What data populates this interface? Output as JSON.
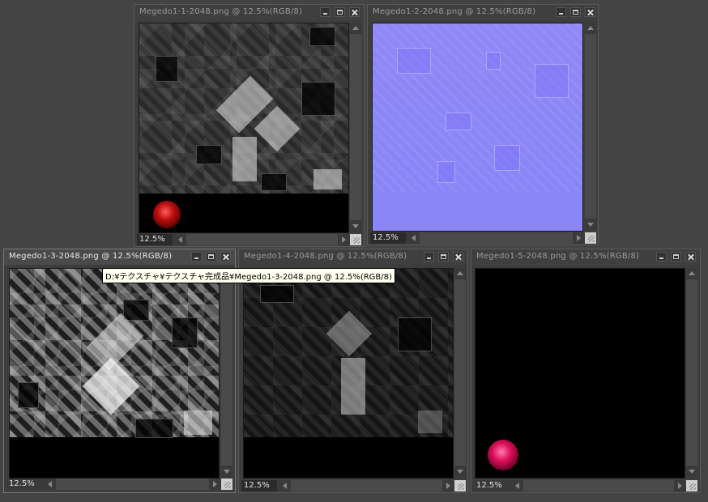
{
  "windows": [
    {
      "title": "Megedo1-1-2048.png @ 12.5%(RGB/8)",
      "zoom": "12.5%"
    },
    {
      "title": "Megedo1-2-2048.png @ 12.5%(RGB/8)",
      "zoom": "12.5%"
    },
    {
      "title": "Megedo1-3-2048.png @ 12.5%(RGB/8)",
      "zoom": "12.5%"
    },
    {
      "title": "Megedo1-4-2048.png @ 12.5%(RGB/8)",
      "zoom": "12.5%"
    },
    {
      "title": "Megedo1-5-2048.png @ 12.5%(RGB/8)",
      "zoom": "12.5%"
    }
  ],
  "tooltip": "D:¥テクスチャ¥テクスチャ完成品¥Megedo1-3-2048.png @ 12.5%(RGB/8)",
  "colors": {
    "workspace": "#444444",
    "normal_map": "#8a86f8",
    "emissive_red": "#c01010",
    "emissive_pink": "#e0105a"
  },
  "icons": [
    "minimize-icon",
    "maximize-icon",
    "close-icon"
  ]
}
